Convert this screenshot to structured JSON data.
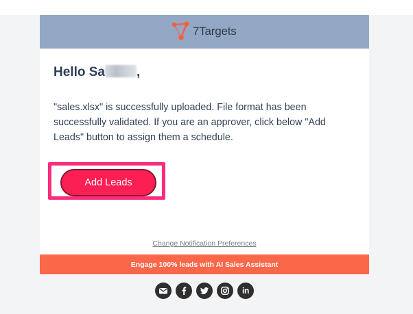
{
  "header": {
    "logo_text": "7Targets"
  },
  "body": {
    "greeting_prefix": "Hello Sa",
    "greeting_suffix": ",",
    "message": "\"sales.xlsx\" is successfully uploaded. File format has been successfully validated. If you are an approver, click below \"Add Leads\" button to assign them a schedule.",
    "add_leads_label": "Add Leads"
  },
  "footer": {
    "preferences_link": "Change Notification Preferences",
    "promo_text": "Engage 100% leads with AI Sales Assistant",
    "social_icons": [
      "email-icon",
      "facebook-icon",
      "twitter-icon",
      "instagram-icon",
      "linkedin-icon"
    ],
    "linkedin_glyph": "in"
  },
  "colors": {
    "header_bg": "#93a8c4",
    "button_bg": "#fc1f54",
    "highlight_border": "#f92d7c",
    "promo_bg": "#fb6749",
    "logo_accent": "#f26145"
  }
}
